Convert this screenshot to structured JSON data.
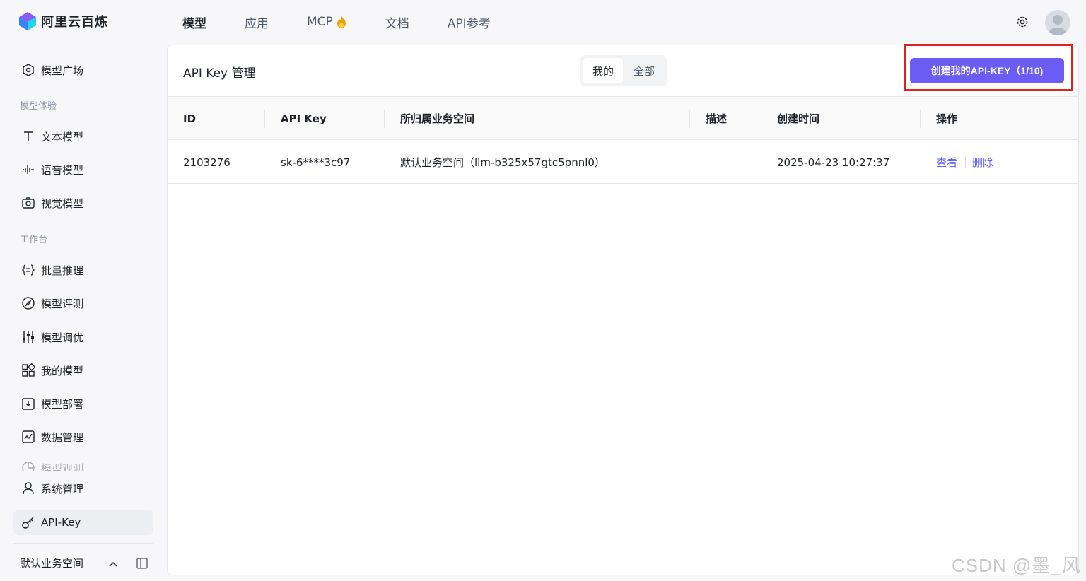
{
  "brand": {
    "name": "阿里云百炼"
  },
  "nav": [
    {
      "label": "模型",
      "active": true
    },
    {
      "label": "应用"
    },
    {
      "label": "MCP"
    },
    {
      "label": "文档"
    },
    {
      "label": "API参考"
    }
  ],
  "sidebar": {
    "top_item": "模型广场",
    "group_experience": "模型体验",
    "experience_items": [
      "文本模型",
      "语音模型",
      "视觉模型"
    ],
    "group_workbench": "工作台",
    "workbench_items": [
      "批量推理",
      "模型评测",
      "模型调优",
      "我的模型",
      "模型部署",
      "数据管理",
      "模型观测"
    ],
    "system": "系统管理",
    "apikey": "API-Key",
    "workspace": "默认业务空间"
  },
  "panel": {
    "title": "API Key 管理",
    "segments": [
      "我的",
      "全部"
    ],
    "create_button": "创建我的API-KEY（1/10)",
    "columns": [
      "ID",
      "API Key",
      "所归属业务空间",
      "描述",
      "创建时间",
      "操作"
    ],
    "rows": [
      {
        "id": "2103276",
        "key": "sk-6****3c97",
        "workspace": "默认业务空间（llm-b325x57gtc5pnnl0）",
        "desc": "",
        "created": "2025-04-23 10:27:37",
        "actions": [
          "查看",
          "删除"
        ]
      }
    ]
  },
  "watermark": "CSDN @墨_风",
  "colors": {
    "primary": "#6a5cf5",
    "link": "#5b5ff5",
    "highlight": "#e02020"
  }
}
